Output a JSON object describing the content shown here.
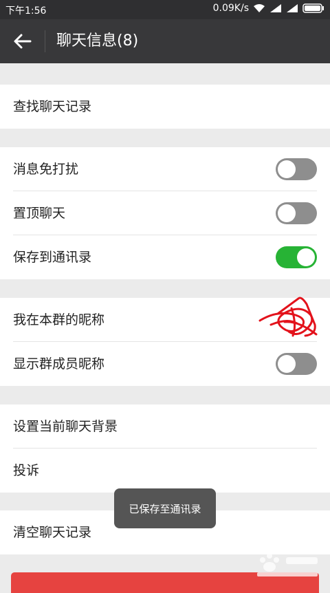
{
  "status_bar": {
    "time": "下午1:56",
    "speed": "0.09K/s"
  },
  "header": {
    "title": "聊天信息(8)"
  },
  "sections": [
    {
      "items": [
        {
          "label": "查找聊天记录"
        }
      ]
    },
    {
      "items": [
        {
          "label": "消息免打扰",
          "toggle": false
        },
        {
          "label": "置顶聊天",
          "toggle": false
        },
        {
          "label": "保存到通讯录",
          "toggle": true
        }
      ]
    },
    {
      "items": [
        {
          "label": "我在本群的昵称"
        },
        {
          "label": "显示群成员昵称",
          "toggle": false
        }
      ]
    },
    {
      "items": [
        {
          "label": "设置当前聊天背景"
        },
        {
          "label": "投诉"
        }
      ]
    },
    {
      "items": [
        {
          "label": "清空聊天记录"
        }
      ]
    }
  ],
  "toast": {
    "message": "已保存至通讯录"
  },
  "colors": {
    "toggle_on": "#27b335",
    "toggle_off": "#8e8e8e",
    "danger": "#e64340",
    "nav_bg": "#38383a"
  }
}
